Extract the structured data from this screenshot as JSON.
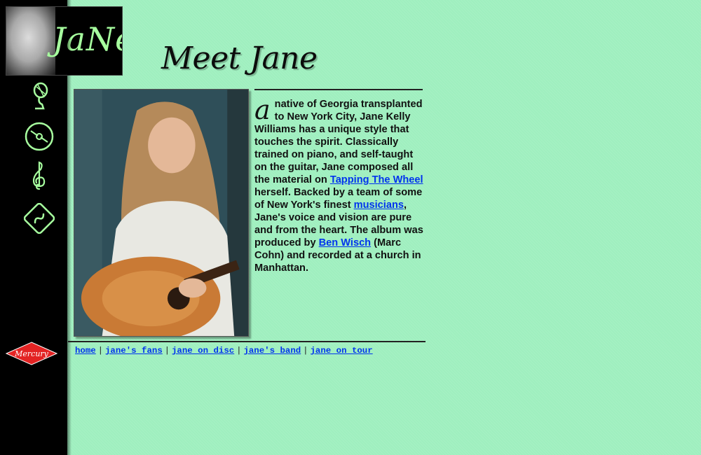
{
  "logo": {
    "text": "JaNe"
  },
  "sidebar": {
    "items": [
      {
        "icon": "microphone-icon"
      },
      {
        "icon": "disc-icon"
      },
      {
        "icon": "treble-clef-icon"
      },
      {
        "icon": "road-sign-icon"
      }
    ],
    "label_logo": "Mercury"
  },
  "title": "Meet Jane",
  "bio": {
    "dropcap": "a",
    "text_1": " native of Georgia transplanted to New York City, Jane Kelly Williams has a unique style that touches the spirit. Classically trained on piano, and self-taught on the guitar, Jane composed all the material on ",
    "link_1": "Tapping The Wheel",
    "text_2": " herself. Backed by a team of some of New York's finest ",
    "link_2": "musicians",
    "text_3": ", Jane's voice and vision are pure and from the heart. The album was produced by ",
    "link_3": "Ben Wisch",
    "text_4": " (Marc Cohn) and recorded at a church in Manhattan."
  },
  "footer_nav": {
    "items": [
      "home",
      "jane's fans",
      "jane on disc",
      "jane's band",
      "jane on tour"
    ],
    "separator": "|"
  },
  "colors": {
    "background": "#9fefbf",
    "sidebar": "#000000",
    "link": "#0033ee",
    "icon_green": "#a7ff9f",
    "mercury_red": "#e32323"
  }
}
